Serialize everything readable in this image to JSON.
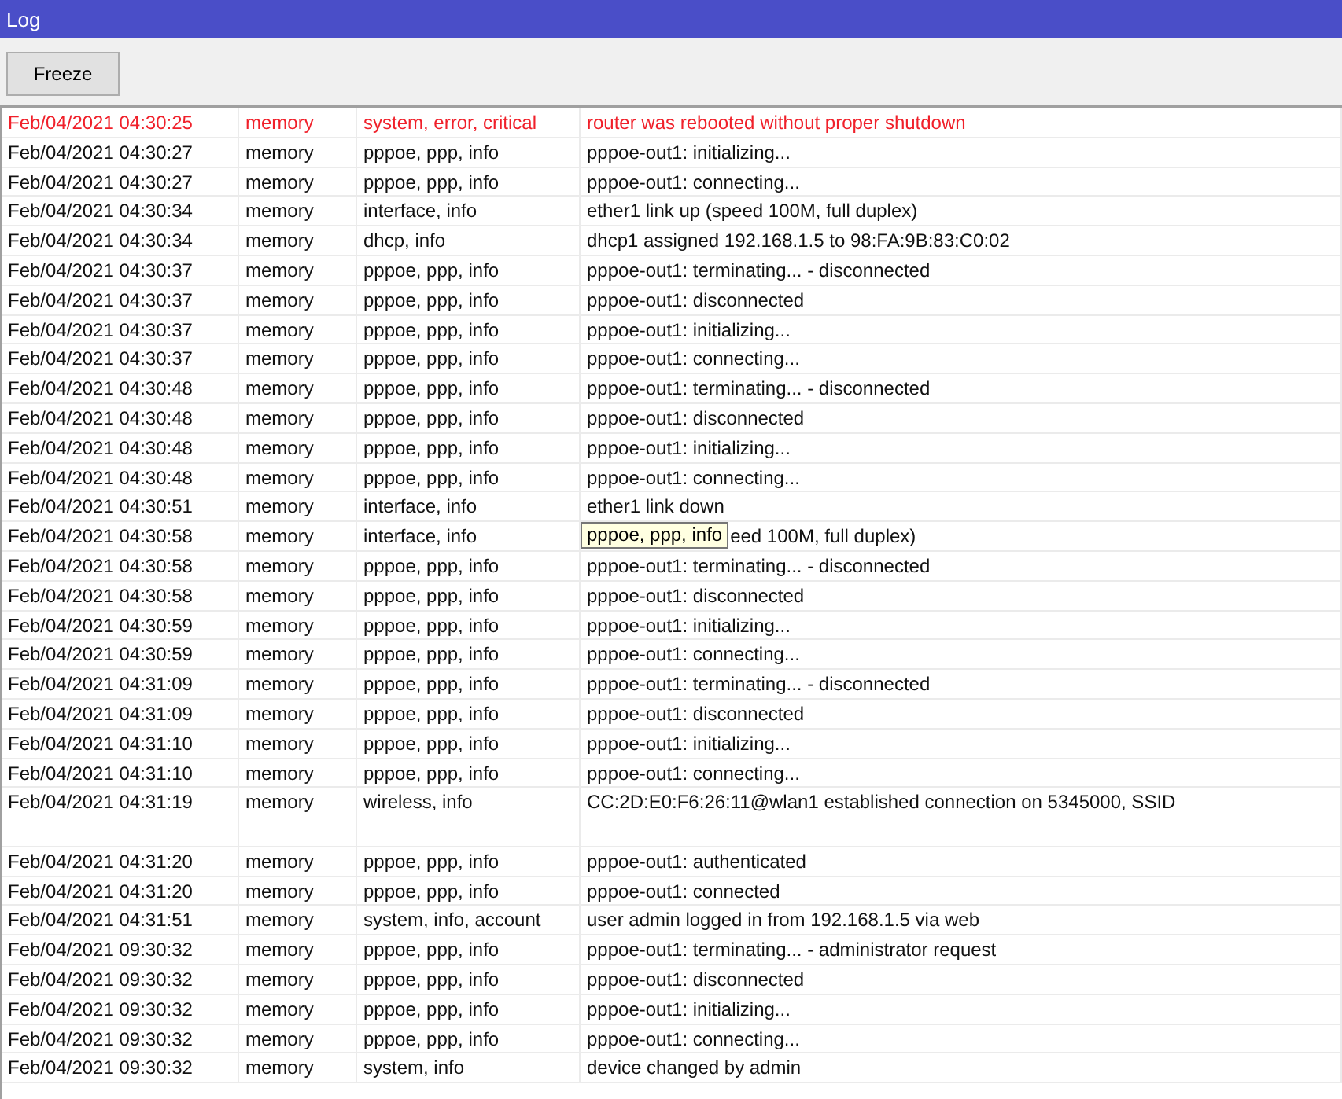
{
  "window": {
    "title": "Log"
  },
  "toolbar": {
    "buttons": [
      "Freeze"
    ]
  },
  "rows": [
    {
      "time": "Feb/04/2021 04:30:25",
      "buffer": "memory",
      "topics": "system, error, critical",
      "message": "router was rebooted without proper shutdown",
      "error": true
    },
    {
      "time": "Feb/04/2021 04:30:27",
      "buffer": "memory",
      "topics": "pppoe, ppp, info",
      "message": "pppoe-out1: initializing...",
      "error": false
    },
    {
      "time": "Feb/04/2021 04:30:27",
      "buffer": "memory",
      "topics": "pppoe, ppp, info",
      "message": "pppoe-out1: connecting...",
      "error": false
    },
    {
      "time": "Feb/04/2021 04:30:34",
      "buffer": "memory",
      "topics": "interface, info",
      "message": "ether1 link up (speed 100M, full duplex)",
      "error": false
    },
    {
      "time": "Feb/04/2021 04:30:34",
      "buffer": "memory",
      "topics": "dhcp, info",
      "message": "dhcp1 assigned 192.168.1.5 to 98:FA:9B:83:C0:02",
      "error": false
    },
    {
      "time": "Feb/04/2021 04:30:37",
      "buffer": "memory",
      "topics": "pppoe, ppp, info",
      "message": "pppoe-out1: terminating... - disconnected",
      "error": false
    },
    {
      "time": "Feb/04/2021 04:30:37",
      "buffer": "memory",
      "topics": "pppoe, ppp, info",
      "message": "pppoe-out1: disconnected",
      "error": false
    },
    {
      "time": "Feb/04/2021 04:30:37",
      "buffer": "memory",
      "topics": "pppoe, ppp, info",
      "message": "pppoe-out1: initializing...",
      "error": false
    },
    {
      "time": "Feb/04/2021 04:30:37",
      "buffer": "memory",
      "topics": "pppoe, ppp, info",
      "message": "pppoe-out1: connecting...",
      "error": false
    },
    {
      "time": "Feb/04/2021 04:30:48",
      "buffer": "memory",
      "topics": "pppoe, ppp, info",
      "message": "pppoe-out1: terminating... - disconnected",
      "error": false
    },
    {
      "time": "Feb/04/2021 04:30:48",
      "buffer": "memory",
      "topics": "pppoe, ppp, info",
      "message": "pppoe-out1: disconnected",
      "error": false
    },
    {
      "time": "Feb/04/2021 04:30:48",
      "buffer": "memory",
      "topics": "pppoe, ppp, info",
      "message": "pppoe-out1: initializing...",
      "error": false
    },
    {
      "time": "Feb/04/2021 04:30:48",
      "buffer": "memory",
      "topics": "pppoe, ppp, info",
      "message": "pppoe-out1: connecting...",
      "error": false
    },
    {
      "time": "Feb/04/2021 04:30:51",
      "buffer": "memory",
      "topics": "interface, info",
      "message": "ether1 link down",
      "error": false
    },
    {
      "time": "Feb/04/2021 04:30:58",
      "buffer": "memory",
      "topics": "interface, info",
      "tooltip": "pppoe, ppp, info",
      "message": "eed 100M, full duplex)",
      "error": false
    },
    {
      "time": "Feb/04/2021 04:30:58",
      "buffer": "memory",
      "topics": "pppoe, ppp, info",
      "message": "pppoe-out1: terminating... - disconnected",
      "error": false
    },
    {
      "time": "Feb/04/2021 04:30:58",
      "buffer": "memory",
      "topics": "pppoe, ppp, info",
      "message": "pppoe-out1: disconnected",
      "error": false
    },
    {
      "time": "Feb/04/2021 04:30:59",
      "buffer": "memory",
      "topics": "pppoe, ppp, info",
      "message": "pppoe-out1: initializing...",
      "error": false
    },
    {
      "time": "Feb/04/2021 04:30:59",
      "buffer": "memory",
      "topics": "pppoe, ppp, info",
      "message": "pppoe-out1: connecting...",
      "error": false
    },
    {
      "time": "Feb/04/2021 04:31:09",
      "buffer": "memory",
      "topics": "pppoe, ppp, info",
      "message": "pppoe-out1: terminating... - disconnected",
      "error": false
    },
    {
      "time": "Feb/04/2021 04:31:09",
      "buffer": "memory",
      "topics": "pppoe, ppp, info",
      "message": "pppoe-out1: disconnected",
      "error": false
    },
    {
      "time": "Feb/04/2021 04:31:10",
      "buffer": "memory",
      "topics": "pppoe, ppp, info",
      "message": "pppoe-out1: initializing...",
      "error": false
    },
    {
      "time": "Feb/04/2021 04:31:10",
      "buffer": "memory",
      "topics": "pppoe, ppp, info",
      "message": "pppoe-out1: connecting...",
      "error": false
    },
    {
      "time": "Feb/04/2021 04:31:19",
      "buffer": "memory",
      "topics": "wireless, info",
      "message": "CC:2D:E0:F6:26:11@wlan1 established connection on 5345000, SSID",
      "error": false,
      "tall": true
    },
    {
      "time": "Feb/04/2021 04:31:20",
      "buffer": "memory",
      "topics": "pppoe, ppp, info",
      "message": "pppoe-out1: authenticated",
      "error": false
    },
    {
      "time": "Feb/04/2021 04:31:20",
      "buffer": "memory",
      "topics": "pppoe, ppp, info",
      "message": "pppoe-out1: connected",
      "error": false
    },
    {
      "time": "Feb/04/2021 04:31:51",
      "buffer": "memory",
      "topics": "system, info, account",
      "message": "user admin logged in from 192.168.1.5 via web",
      "error": false
    },
    {
      "time": "Feb/04/2021 09:30:32",
      "buffer": "memory",
      "topics": "pppoe, ppp, info",
      "message": "pppoe-out1: terminating... - administrator request",
      "error": false
    },
    {
      "time": "Feb/04/2021 09:30:32",
      "buffer": "memory",
      "topics": "pppoe, ppp, info",
      "message": "pppoe-out1: disconnected",
      "error": false
    },
    {
      "time": "Feb/04/2021 09:30:32",
      "buffer": "memory",
      "topics": "pppoe, ppp, info",
      "message": "pppoe-out1: initializing...",
      "error": false
    },
    {
      "time": "Feb/04/2021 09:30:32",
      "buffer": "memory",
      "topics": "pppoe, ppp, info",
      "message": "pppoe-out1: connecting...",
      "error": false
    },
    {
      "time": "Feb/04/2021 09:30:32",
      "buffer": "memory",
      "topics": "system, info",
      "message": "device changed by admin",
      "error": false
    }
  ]
}
